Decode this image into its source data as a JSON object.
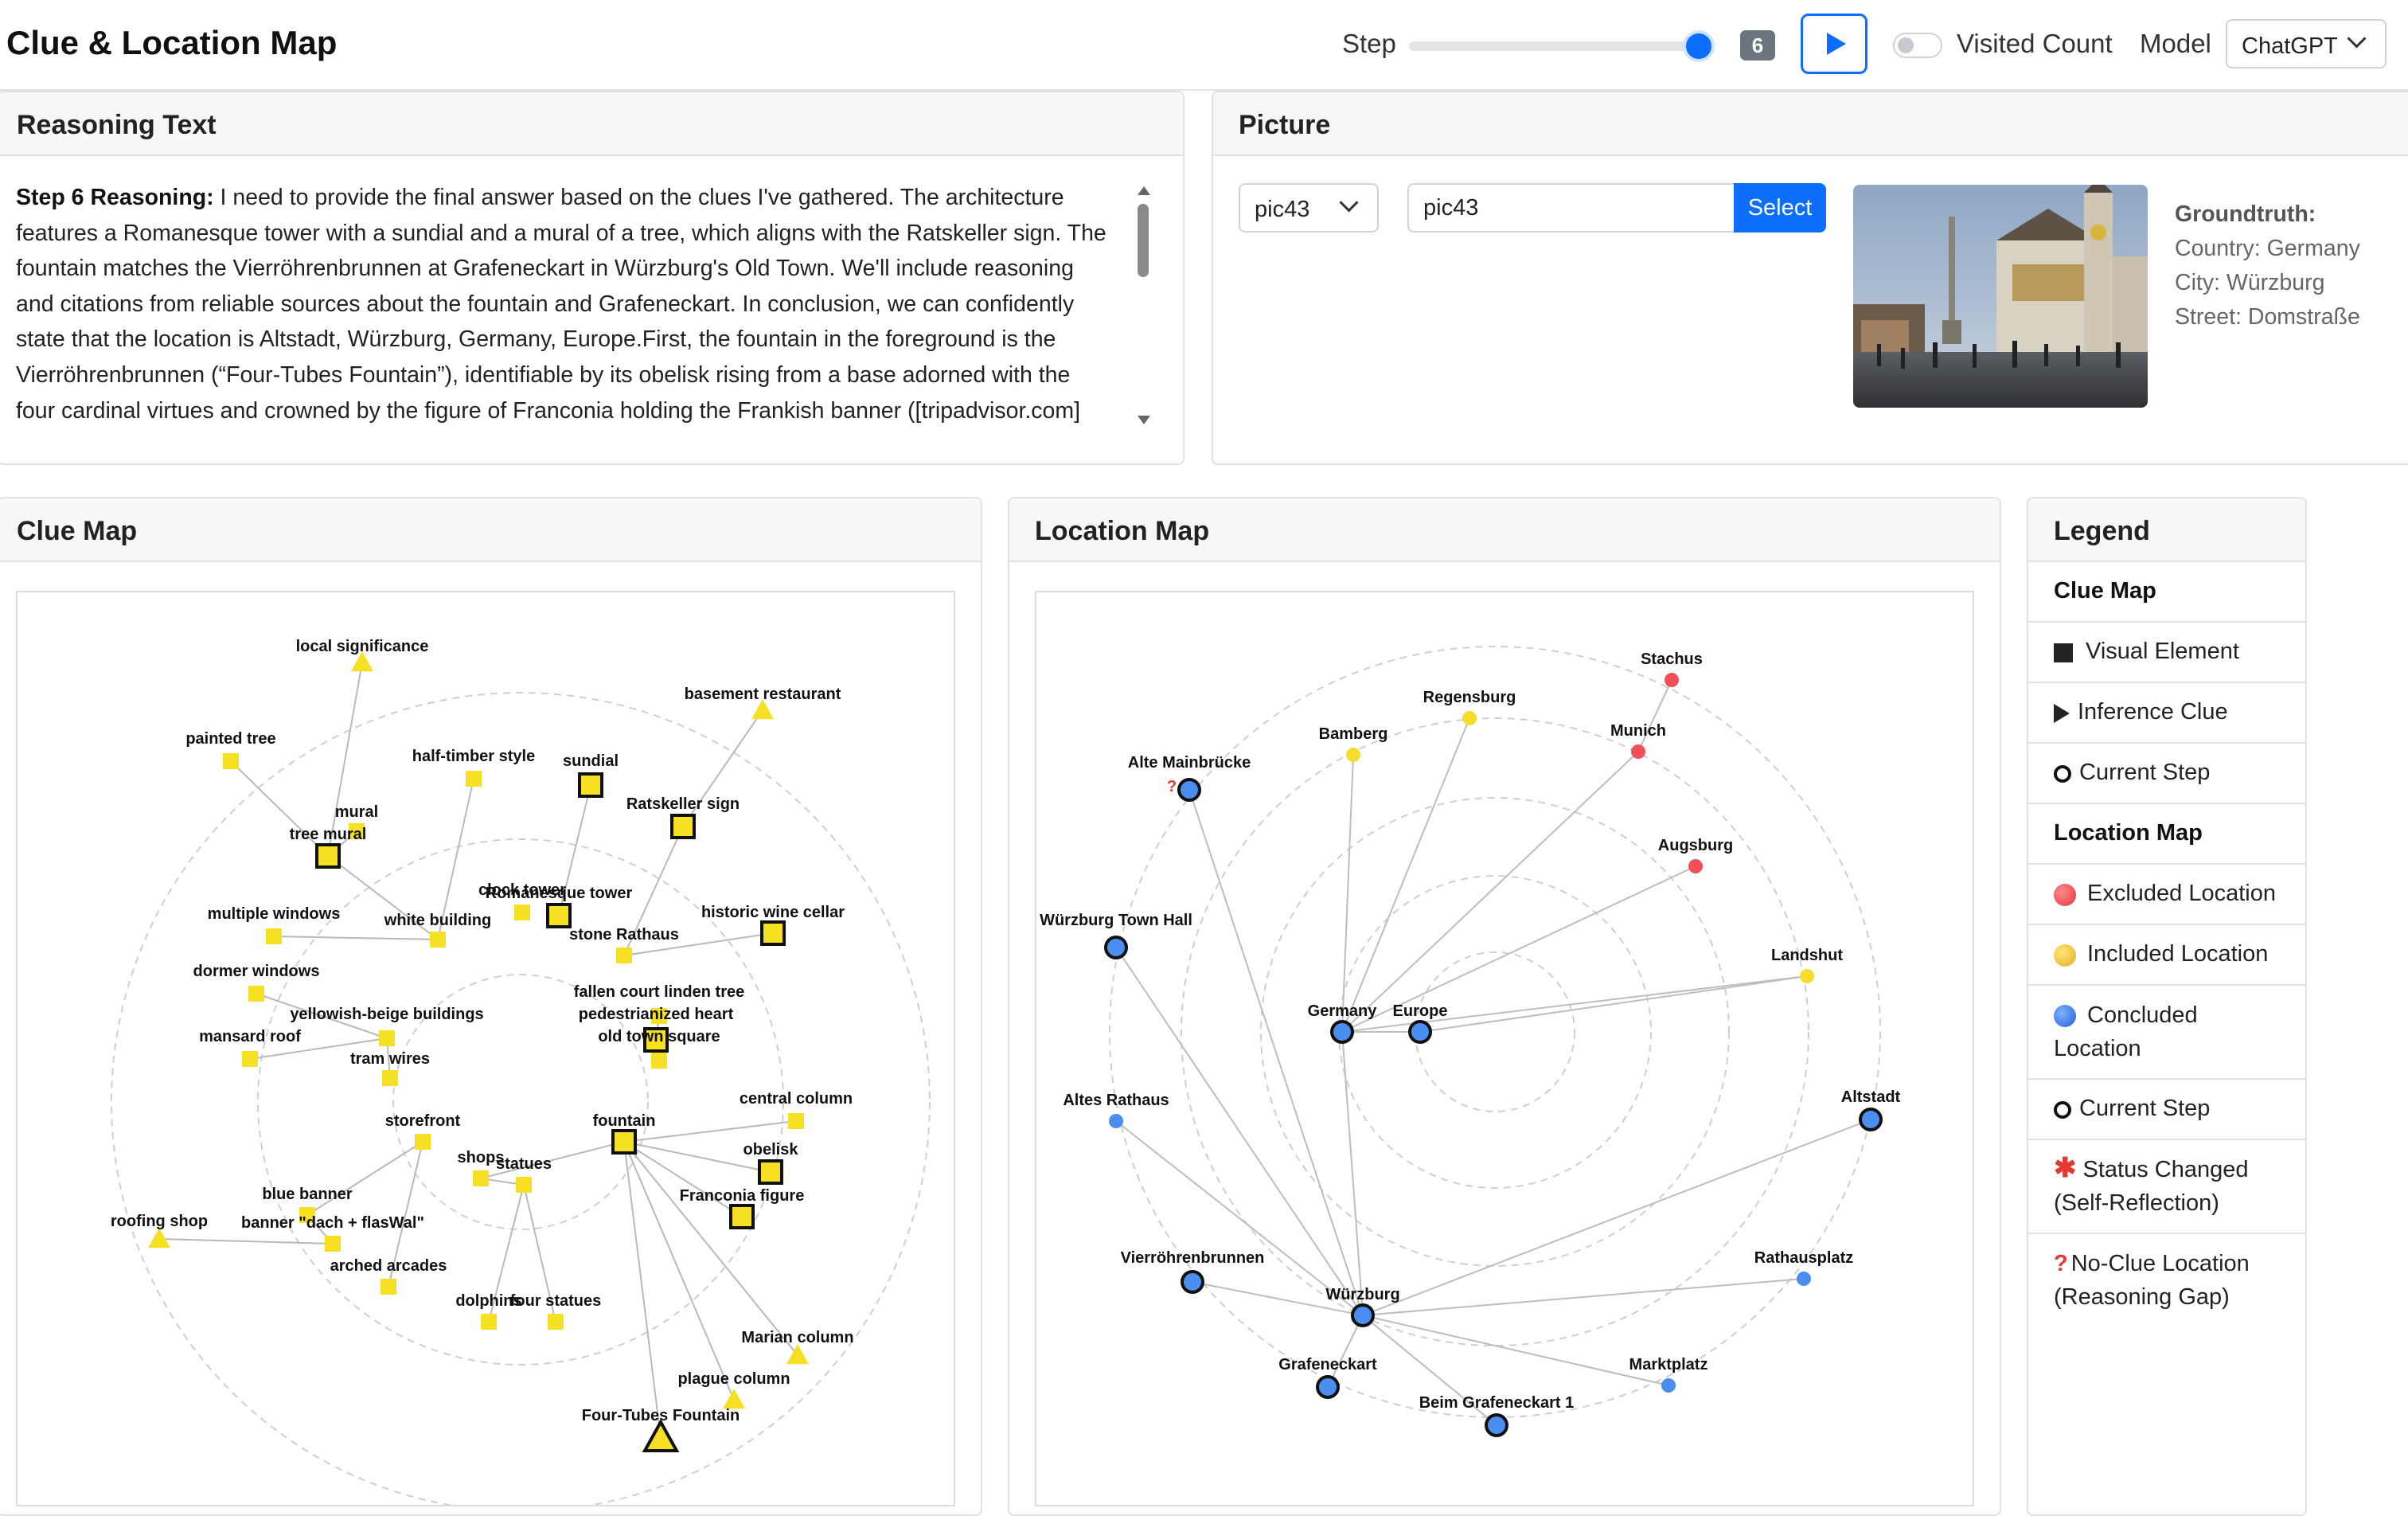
{
  "header": {
    "title": "Clue & Location Map",
    "step_label": "Step",
    "step_value": "6",
    "step_fraction": 1.0,
    "visited_label": "Visited Count",
    "visited_on": false,
    "model_label": "Model",
    "model_value": "ChatGPT",
    "play_icon": "play-icon"
  },
  "reasoning": {
    "title": "Reasoning Text",
    "step_heading": "Step 6 Reasoning:",
    "lines": [
      " I need to provide the final answer based on the clues I've gathered. The architecture",
      "features a Romanesque tower with a sundial and a mural of a tree, which aligns with the Ratskeller sign. The",
      "fountain matches the Vierröhrenbrunnen at Grafeneckart in Würzburg's Old Town. We'll include reasoning",
      "and citations from reliable sources about the fountain and Grafeneckart. In conclusion, we can confidently",
      "state that the location is Altstadt, Würzburg, Germany, Europe.First, the fountain in the foreground is the",
      "Vierröhrenbrunnen (“Four-Tubes Fountain”), identifiable by its obelisk rising from a base adorned with the",
      "four cardinal virtues and crowned by the figure of Franconia holding the Frankish banner ([tripadvisor.com]"
    ]
  },
  "picture": {
    "title": "Picture",
    "selected": "pic43",
    "input_value": "pic43",
    "select_button": "Select",
    "groundtruth_title": "Groundtruth:",
    "country": "Country: Germany",
    "city": "City: Würzburg",
    "street": "Street: Domstraße"
  },
  "clue_map": {
    "title": "Clue Map",
    "nodes": [
      {
        "label": "local significance",
        "shape": "triangle",
        "current": false
      },
      {
        "label": "basement restaurant",
        "shape": "triangle",
        "current": false
      },
      {
        "label": "painted tree",
        "shape": "square",
        "current": false
      },
      {
        "label": "half-timber style",
        "shape": "square",
        "current": false
      },
      {
        "label": "sundial",
        "shape": "square",
        "current": true
      },
      {
        "label": "mural",
        "shape": "square",
        "current": false
      },
      {
        "label": "tree mural",
        "shape": "square",
        "current": true
      },
      {
        "label": "Ratskeller sign",
        "shape": "square",
        "current": true
      },
      {
        "label": "clock tower",
        "shape": "square",
        "current": false
      },
      {
        "label": "Romanesque tower",
        "shape": "square",
        "current": true
      },
      {
        "label": "multiple windows",
        "shape": "square",
        "current": false
      },
      {
        "label": "white building",
        "shape": "square",
        "current": false
      },
      {
        "label": "historic wine cellar",
        "shape": "square",
        "current": true
      },
      {
        "label": "stone Rathaus",
        "shape": "square",
        "current": false
      },
      {
        "label": "dormer windows",
        "shape": "square",
        "current": false
      },
      {
        "label": "fallen court linden tree",
        "shape": "square",
        "current": false
      },
      {
        "label": "yellowish-beige buildings",
        "shape": "square",
        "current": false
      },
      {
        "label": "pedestrianized heart",
        "shape": "square",
        "current": true
      },
      {
        "label": "mansard roof",
        "shape": "square",
        "current": false
      },
      {
        "label": "old town square",
        "shape": "square",
        "current": false
      },
      {
        "label": "tram wires",
        "shape": "square",
        "current": false
      },
      {
        "label": "central column",
        "shape": "square",
        "current": false
      },
      {
        "label": "storefront",
        "shape": "square",
        "current": false
      },
      {
        "label": "fountain",
        "shape": "square",
        "current": true
      },
      {
        "label": "obelisk",
        "shape": "square",
        "current": true
      },
      {
        "label": "shops",
        "shape": "square",
        "current": false
      },
      {
        "label": "statues",
        "shape": "square",
        "current": false
      },
      {
        "label": "Franconia figure",
        "shape": "square",
        "current": true
      },
      {
        "label": "blue banner",
        "shape": "square",
        "current": false
      },
      {
        "label": "roofing shop",
        "shape": "triangle",
        "current": false
      },
      {
        "label": "banner \"dach + flasWal\"",
        "shape": "square",
        "current": false
      },
      {
        "label": "arched arcades",
        "shape": "square",
        "current": false
      },
      {
        "label": "dolphins",
        "shape": "square",
        "current": false
      },
      {
        "label": "four statues",
        "shape": "square",
        "current": false
      },
      {
        "label": "Marian column",
        "shape": "triangle",
        "current": false
      },
      {
        "label": "plague column",
        "shape": "triangle",
        "current": false
      },
      {
        "label": "Four-Tubes Fountain",
        "shape": "triangle",
        "current": true
      }
    ],
    "edges": [
      [
        "local significance",
        "tree mural"
      ],
      [
        "painted tree",
        "tree mural"
      ],
      [
        "basement restaurant",
        "Ratskeller sign"
      ],
      [
        "half-timber style",
        "white building"
      ],
      [
        "mural",
        "tree mural"
      ],
      [
        "tree mural",
        "white building"
      ],
      [
        "sundial",
        "Romanesque tower"
      ],
      [
        "Ratskeller sign",
        "stone Rathaus"
      ],
      [
        "multiple windows",
        "white building"
      ],
      [
        "historic wine cellar",
        "stone Rathaus"
      ],
      [
        "dormer windows",
        "yellowish-beige buildings"
      ],
      [
        "mansard roof",
        "yellowish-beige buildings"
      ],
      [
        "yellowish-beige buildings",
        "tram wires"
      ],
      [
        "fallen court linden tree",
        "pedestrianized heart"
      ],
      [
        "pedestrianized heart",
        "old town square"
      ],
      [
        "storefront",
        "blue banner"
      ],
      [
        "storefront",
        "arched arcades"
      ],
      [
        "blue banner",
        "banner \"dach + flasWal\""
      ],
      [
        "roofing shop",
        "banner \"dach + flasWal\""
      ],
      [
        "shops",
        "statues"
      ],
      [
        "statues",
        "dolphins"
      ],
      [
        "statues",
        "four statues"
      ],
      [
        "fountain",
        "central column"
      ],
      [
        "fountain",
        "obelisk"
      ],
      [
        "fountain",
        "Franconia figure"
      ],
      [
        "fountain",
        "Marian column"
      ],
      [
        "fountain",
        "plague column"
      ],
      [
        "fountain",
        "Four-Tubes Fountain"
      ],
      [
        "fountain",
        "shops"
      ]
    ]
  },
  "location_map": {
    "title": "Location Map",
    "nodes": [
      {
        "label": "Stachus",
        "status": "excluded",
        "current": false,
        "no_clue": false
      },
      {
        "label": "Regensburg",
        "status": "included",
        "current": false,
        "no_clue": false
      },
      {
        "label": "Bamberg",
        "status": "included",
        "current": false,
        "no_clue": false
      },
      {
        "label": "Munich",
        "status": "excluded",
        "current": false,
        "no_clue": false
      },
      {
        "label": "Alte Mainbrücke",
        "status": "concluded",
        "current": true,
        "no_clue": true
      },
      {
        "label": "Augsburg",
        "status": "excluded",
        "current": false,
        "no_clue": false
      },
      {
        "label": "Würzburg Town Hall",
        "status": "concluded",
        "current": true,
        "no_clue": false
      },
      {
        "label": "Landshut",
        "status": "included",
        "current": false,
        "no_clue": false
      },
      {
        "label": "Germany",
        "status": "concluded",
        "current": true,
        "no_clue": false
      },
      {
        "label": "Europe",
        "status": "concluded",
        "current": true,
        "no_clue": false
      },
      {
        "label": "Altes Rathaus",
        "status": "concluded",
        "current": false,
        "no_clue": false
      },
      {
        "label": "Altstadt",
        "status": "concluded",
        "current": true,
        "no_clue": false
      },
      {
        "label": "Vierröhrenbrunnen",
        "status": "concluded",
        "current": true,
        "no_clue": false
      },
      {
        "label": "Rathausplatz",
        "status": "concluded",
        "current": false,
        "no_clue": false
      },
      {
        "label": "Würzburg",
        "status": "concluded",
        "current": true,
        "no_clue": false
      },
      {
        "label": "Grafeneckart",
        "status": "concluded",
        "current": true,
        "no_clue": false
      },
      {
        "label": "Marktplatz",
        "status": "concluded",
        "current": false,
        "no_clue": false
      },
      {
        "label": "Beim Grafeneckart 1",
        "status": "concluded",
        "current": true,
        "no_clue": false
      }
    ],
    "edges": [
      [
        "Germany",
        "Europe"
      ],
      [
        "Germany",
        "Regensburg"
      ],
      [
        "Germany",
        "Bamberg"
      ],
      [
        "Germany",
        "Munich"
      ],
      [
        "Germany",
        "Augsburg"
      ],
      [
        "Germany",
        "Landshut"
      ],
      [
        "Germany",
        "Würzburg"
      ],
      [
        "Europe",
        "Landshut"
      ],
      [
        "Munich",
        "Stachus"
      ],
      [
        "Würzburg",
        "Alte Mainbrücke"
      ],
      [
        "Würzburg",
        "Würzburg Town Hall"
      ],
      [
        "Würzburg",
        "Altes Rathaus"
      ],
      [
        "Würzburg",
        "Altstadt"
      ],
      [
        "Würzburg",
        "Vierröhrenbrunnen"
      ],
      [
        "Würzburg",
        "Rathausplatz"
      ],
      [
        "Würzburg",
        "Grafeneckart"
      ],
      [
        "Würzburg",
        "Marktplatz"
      ],
      [
        "Würzburg",
        "Beim Grafeneckart 1"
      ]
    ]
  },
  "legend": {
    "title": "Legend",
    "clue_heading": "Clue Map",
    "visual_element": "Visual Element",
    "inference_clue": "Inference Clue",
    "current_step": "Current Step",
    "location_heading": "Location Map",
    "excluded": "Excluded Location",
    "included": "Included Location",
    "concluded_line1": "Concluded",
    "concluded_line2": "Location",
    "current_step_2": "Current Step",
    "status_line1": "Status Changed",
    "status_line2": "(Self-Reflection)",
    "noclue_line1": "No-Clue Location",
    "noclue_line2": "(Reasoning Gap)",
    "star_symbol": "✱",
    "question_symbol": "?"
  },
  "colors": {
    "accent": "#0d6efd",
    "clue_yellow": "#f6e023",
    "excluded": "#ef4f55",
    "included": "#f5dd2c",
    "concluded": "#4a8ef0"
  }
}
